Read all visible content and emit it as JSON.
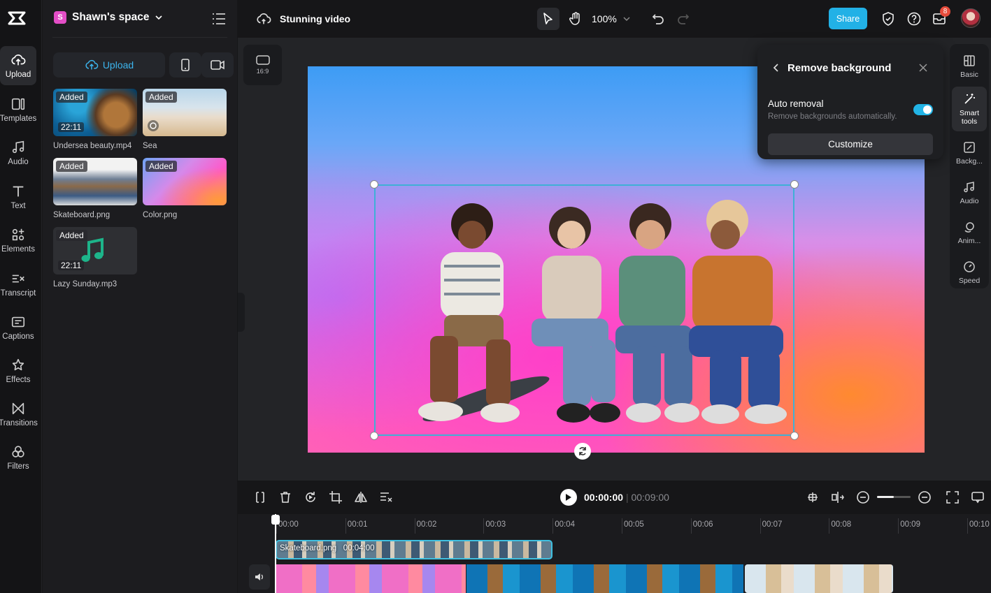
{
  "sidebar": {
    "items": [
      {
        "label": "Upload",
        "icon": "cloud-upload-icon"
      },
      {
        "label": "Templates",
        "icon": "templates-icon"
      },
      {
        "label": "Audio",
        "icon": "music-note-icon"
      },
      {
        "label": "Text",
        "icon": "text-icon"
      },
      {
        "label": "Elements",
        "icon": "elements-icon"
      },
      {
        "label": "Transcript",
        "icon": "transcript-icon"
      },
      {
        "label": "Captions",
        "icon": "captions-icon"
      },
      {
        "label": "Effects",
        "icon": "effects-icon"
      },
      {
        "label": "Transitions",
        "icon": "transitions-icon"
      },
      {
        "label": "Filters",
        "icon": "filters-icon"
      }
    ]
  },
  "media_panel": {
    "space_badge": "S",
    "space_name": "Shawn's space",
    "upload_label": "Upload",
    "items": [
      {
        "name": "Undersea beauty.mp4",
        "badge": "Added",
        "duration": "22:11"
      },
      {
        "name": "Sea",
        "badge": "Added"
      },
      {
        "name": "Skateboard.png",
        "badge": "Added"
      },
      {
        "name": "Color.png",
        "badge": "Added"
      },
      {
        "name": "Lazy Sunday.mp3",
        "badge": "Added",
        "duration": "22:11"
      }
    ]
  },
  "header": {
    "project_title": "Stunning video",
    "zoom": "100%",
    "share_label": "Share",
    "notification_count": "8"
  },
  "stage": {
    "aspect_ratio": "16:9"
  },
  "remove_bg": {
    "title": "Remove background",
    "auto_label": "Auto removal",
    "auto_desc": "Remove backgrounds automatically.",
    "auto_enabled": true,
    "customize_label": "Customize"
  },
  "properties": {
    "items": [
      {
        "label": "Basic"
      },
      {
        "label": "Smart tools"
      },
      {
        "label": "Backg..."
      },
      {
        "label": "Audio"
      },
      {
        "label": "Anim..."
      },
      {
        "label": "Speed"
      }
    ]
  },
  "player": {
    "current_time": "00:00:00",
    "separator": "|",
    "total_time": "00:09:00"
  },
  "timeline": {
    "ticks": [
      "00:00",
      "00:01",
      "00:02",
      "00:03",
      "00:04",
      "00:05",
      "00:06",
      "00:07",
      "00:08",
      "00:09",
      "00:10"
    ],
    "overlay_clip": {
      "name": "Skateboard.png",
      "duration": "00:04:00"
    }
  },
  "colors": {
    "accent": "#22b1e6",
    "panel": "#1c1c1f",
    "background": "#161618"
  }
}
